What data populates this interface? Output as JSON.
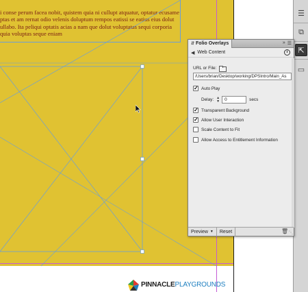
{
  "document": {
    "body_lines": [
      "",
      "i conse perum facea nobit, quistem quia ni cullupt atquatur, optatur ecusamet",
      "ptas et am rernat odio velenis doluptum rempos eatissi se eatius eius dolut",
      "ullabo. Ita peliqui optatis acias a nam que dolut voluptatas sequi corporia",
      "quia voluptas seque eniam"
    ],
    "logo": {
      "bold": "PINNACLE",
      "light": "PLAYGROUNDS"
    }
  },
  "panel": {
    "tab_title": "Folio Overlays",
    "header": "Web Content",
    "url_label": "URL or File:",
    "url_value": "/Users/brian/Desktop/working/DPSIntro/Main_As",
    "auto_play_label": "Auto Play",
    "auto_play_checked": true,
    "delay_label": "Delay:",
    "delay_value": "0",
    "delay_unit": "secs",
    "options": [
      {
        "label": "Transparent Background",
        "checked": true
      },
      {
        "label": "Allow User Interaction",
        "checked": true
      },
      {
        "label": "Scale Content to Fit",
        "checked": false
      },
      {
        "label": "Allow Access to Entitlement Information",
        "checked": false
      }
    ],
    "footer": {
      "preview_label": "Preview",
      "reset_label": "Reset"
    }
  },
  "colors": {
    "page_fill": "#e0c232",
    "frame_stroke": "#6a9ed8",
    "guide": "#c45bd6",
    "text": "#7a1e14"
  },
  "icons": [
    "pages-icon",
    "layers-icon",
    "folio-overlays-icon",
    "links-icon",
    "info-icon",
    "folder-icon",
    "trash-icon",
    "back-arrow-icon"
  ]
}
